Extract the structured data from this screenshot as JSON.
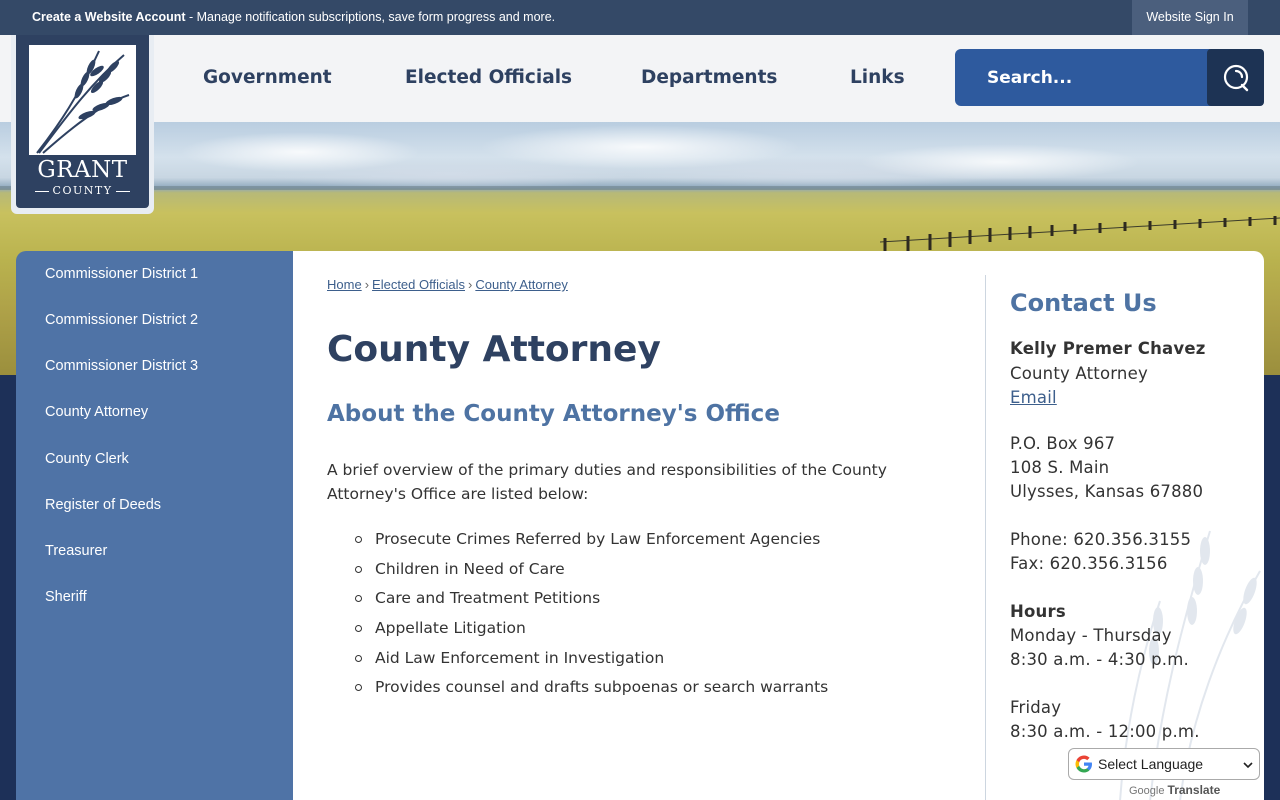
{
  "topbar": {
    "account_link": "Create a Website Account",
    "account_desc": " - Manage notification subscriptions, save form progress and more.",
    "signin": "Website Sign In"
  },
  "logo": {
    "name": "GRANT",
    "sub": "COUNTY"
  },
  "nav": {
    "items": [
      "Government",
      "Elected Officials",
      "Departments",
      "Links"
    ]
  },
  "search": {
    "placeholder": "Search..."
  },
  "sidebar": {
    "items": [
      "Commissioner District 1",
      "Commissioner District 2",
      "Commissioner District 3",
      "County Attorney",
      "County Clerk",
      "Register of Deeds",
      "Treasurer",
      "Sheriff"
    ]
  },
  "breadcrumb": {
    "items": [
      "Home",
      "Elected Officials",
      "County Attorney"
    ],
    "separator": "›"
  },
  "main": {
    "title": "County Attorney",
    "subtitle": "About the County Attorney's Office",
    "intro": "A brief overview of the primary duties and responsibilities of the County Attorney's Office are listed below:",
    "duties": [
      "Prosecute Crimes Referred by Law Enforcement Agencies",
      "Children in Need of Care",
      "Care and Treatment Petitions",
      "Appellate Litigation",
      "Aid Law Enforcement in Investigation",
      "Provides counsel and drafts subpoenas or search warrants"
    ]
  },
  "contact": {
    "heading": "Contact Us",
    "name": "Kelly Premer Chavez",
    "role": "County Attorney",
    "email_label": "Email",
    "po_box": "P.O. Box 967",
    "street": "108 S. Main",
    "city": "Ulysses, Kansas 67880",
    "phone": "Phone: 620.356.3155",
    "fax": "Fax: 620.356.3156",
    "hours_heading": "Hours",
    "weekday_days": "Monday - Thursday",
    "weekday_hours": "8:30 a.m. - 4:30 p.m.",
    "friday_days": "Friday",
    "friday_hours": "8:30 a.m. - 12:00 p.m."
  },
  "translate": {
    "select_label": "Select Language",
    "powered_by": "Google",
    "translate_word": "Translate"
  },
  "colors": {
    "navy": "#2e4161",
    "accent_blue": "#4e73a3",
    "sidebar_blue": "#4f73a6",
    "search_blue": "#2e5a9e"
  }
}
